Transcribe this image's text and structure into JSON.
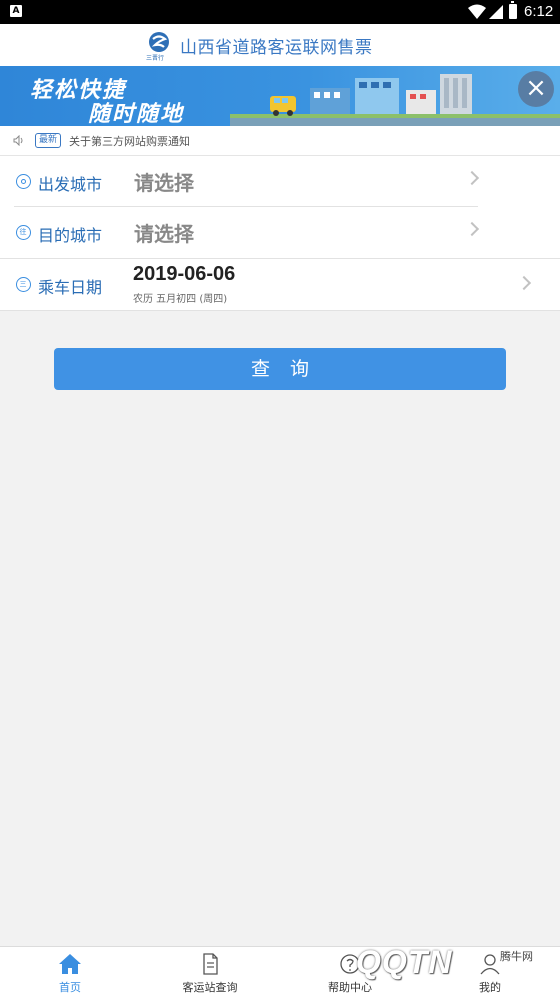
{
  "status_bar": {
    "time": "6:12",
    "notification_letter": "A"
  },
  "header": {
    "title": "山西省道路客运联网售票",
    "logo_text": "三晋行"
  },
  "banner": {
    "slogan_line1": "轻松快捷",
    "slogan_line2": "随时随地",
    "close_symbol": "×"
  },
  "notice": {
    "badge": "最新",
    "text": "关于第三方网站购票通知"
  },
  "form": {
    "departure": {
      "label": "出发城市",
      "placeholder": "请选择"
    },
    "destination": {
      "label": "目的城市",
      "placeholder": "请选择",
      "icon_text": "往"
    },
    "date": {
      "label": "乘车日期",
      "value": "2019-06-06",
      "lunar": "农历 五月初四 (周四)",
      "icon_text": "三"
    }
  },
  "search": {
    "label": "查询"
  },
  "bottom_nav": {
    "items": [
      {
        "label": "首页",
        "icon": "home-icon",
        "active": true
      },
      {
        "label": "客运站查询",
        "icon": "document-icon",
        "active": false
      },
      {
        "label": "帮助中心",
        "icon": "help-icon",
        "active": false
      },
      {
        "label": "我的",
        "icon": "user-icon",
        "active": false
      }
    ]
  },
  "watermark": {
    "text": "QQTN",
    "small": "腾牛网"
  },
  "colors": {
    "primary": "#4092e4",
    "label_blue": "#2a6db5",
    "background": "#f2f2f2"
  }
}
